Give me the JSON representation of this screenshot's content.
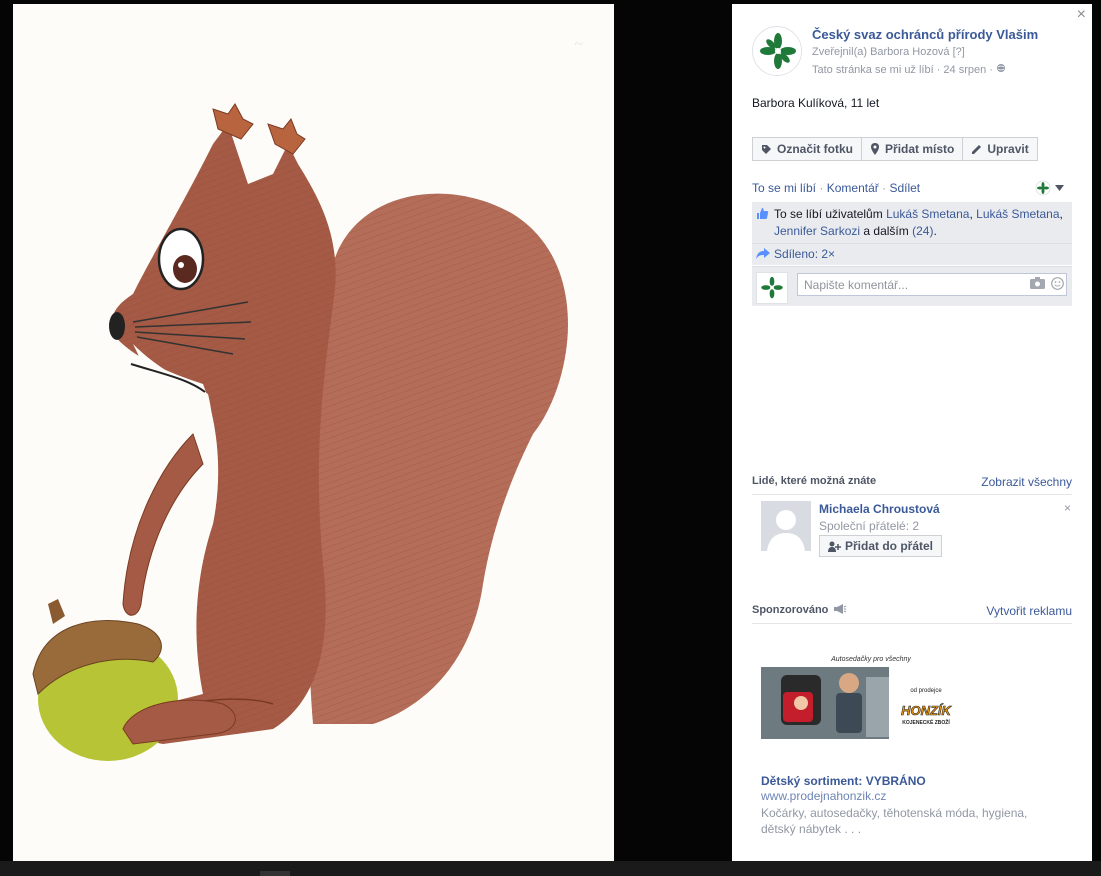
{
  "page": {
    "name": "Český svaz ochránců přírody Vlašim",
    "published_by": "Zveřejnil(a) Barbora Hozová",
    "help": "[?]",
    "like_meta": "Tato stránka se mi už líbí · 24 srpen ·"
  },
  "close_label": "×",
  "caption": "Barbora Kulíková, 11 let",
  "toolbar": {
    "tag_label": "Označit fotku",
    "place_label": "Přidat místo",
    "edit_label": "Upravit"
  },
  "actions": {
    "like": "To se mi líbí",
    "comment": "Komentář",
    "share": "Sdílet",
    "sep": "·"
  },
  "likes": {
    "prefix": "To se líbí uživatelům",
    "user1": "Lukáš Smetana",
    "user2": "Lukáš Smetana",
    "user3": "Jennifer Sarkozi",
    "and_others": "a dalším",
    "count": "(24)",
    "comma": ",",
    "period": "."
  },
  "shares": {
    "label": "Sdíleno: 2×"
  },
  "comment": {
    "placeholder": "Napište komentář..."
  },
  "people": {
    "title": "Lidé, které možná znáte",
    "see_all": "Zobrazit všechny",
    "person_name": "Michaela Chroustová",
    "mutual": "Společní přátelé: 2",
    "add_label": "Přidat do přátel",
    "dismiss": "×"
  },
  "sponsored": {
    "title": "Sponzorováno",
    "create_ad": "Vytvořit reklamu",
    "ad_banner_text": "Autosedačky pro všechny",
    "ad_from": "od prodejce",
    "ad_brand": "HONZÍK",
    "ad_brand_sub": "KOJENECKÉ ZBOŽÍ",
    "ad_title": "Dětský sortiment: VYBRÁNO",
    "ad_url": "www.prodejnahonzik.cz",
    "ad_desc": "Kočárky, autosedačky, těhotenská móda, hygiena, dětský nábytek . . ."
  },
  "logo_text": "Český svaz ochránců přírody",
  "colors": {
    "link": "#3b5998",
    "green": "#1f7a3a",
    "squirrel": "#a45a44",
    "acorn": "#b6c436"
  },
  "icons": {
    "tag": "tag-icon",
    "place": "map-pin-icon",
    "edit": "pencil-icon",
    "thumb": "thumbs-up-icon",
    "share": "share-arrow-icon",
    "camera": "camera-icon",
    "smiley": "smiley-icon",
    "megaphone": "megaphone-icon",
    "add_friend": "add-friend-icon"
  }
}
